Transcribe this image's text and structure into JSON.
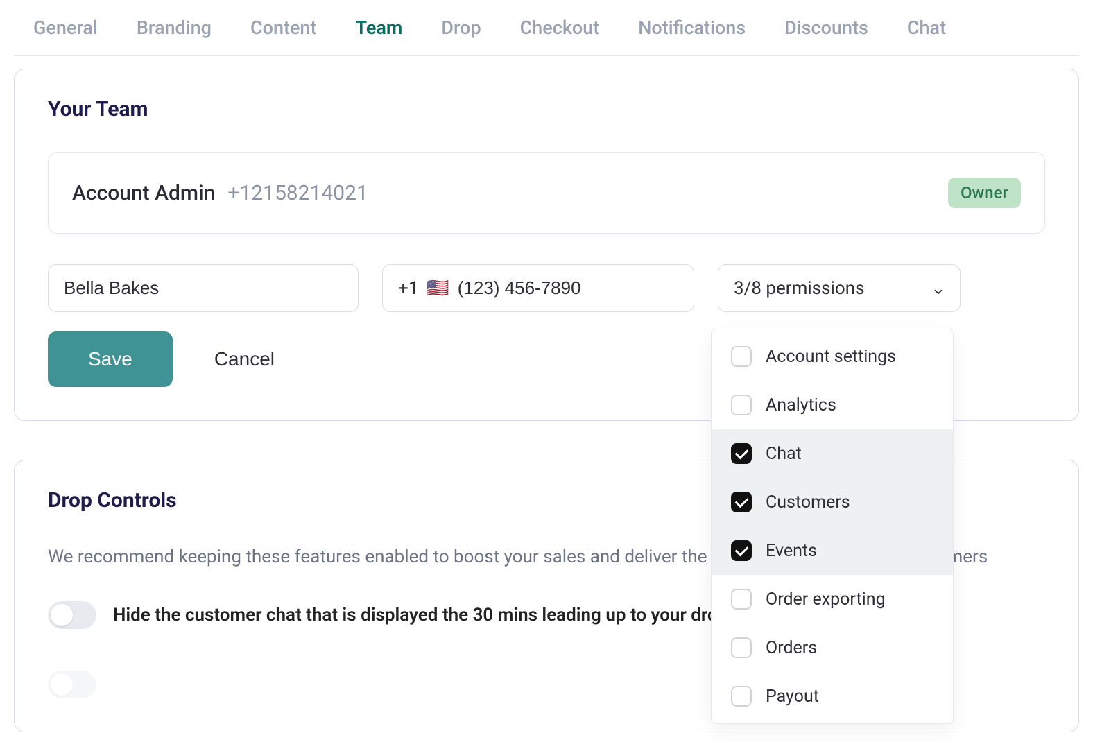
{
  "tabs": {
    "items": [
      "General",
      "Branding",
      "Content",
      "Team",
      "Drop",
      "Checkout",
      "Notifications",
      "Discounts",
      "Chat"
    ],
    "active_index": 3
  },
  "team": {
    "title": "Your Team",
    "admin": {
      "name": "Account Admin",
      "phone": "+12158214021",
      "badge": "Owner"
    },
    "new_member": {
      "name_value": "Bella Bakes",
      "phone_cc": "+1",
      "phone_flag": "🇺🇸",
      "phone_value": "(123) 456-7890",
      "permissions_label": "3/8 permissions"
    },
    "save_label": "Save",
    "cancel_label": "Cancel",
    "permissions": [
      {
        "label": "Account settings",
        "checked": false
      },
      {
        "label": "Analytics",
        "checked": false
      },
      {
        "label": "Chat",
        "checked": true
      },
      {
        "label": "Customers",
        "checked": true
      },
      {
        "label": "Events",
        "checked": true
      },
      {
        "label": "Order exporting",
        "checked": false
      },
      {
        "label": "Orders",
        "checked": false
      },
      {
        "label": "Payout",
        "checked": false
      }
    ]
  },
  "drop_controls": {
    "title": "Drop Controls",
    "description": "We recommend keeping these features enabled to boost your sales and deliver the best experience to your customers",
    "toggle1_label": "Hide the customer chat that is displayed the 30 mins leading up to your drop"
  }
}
